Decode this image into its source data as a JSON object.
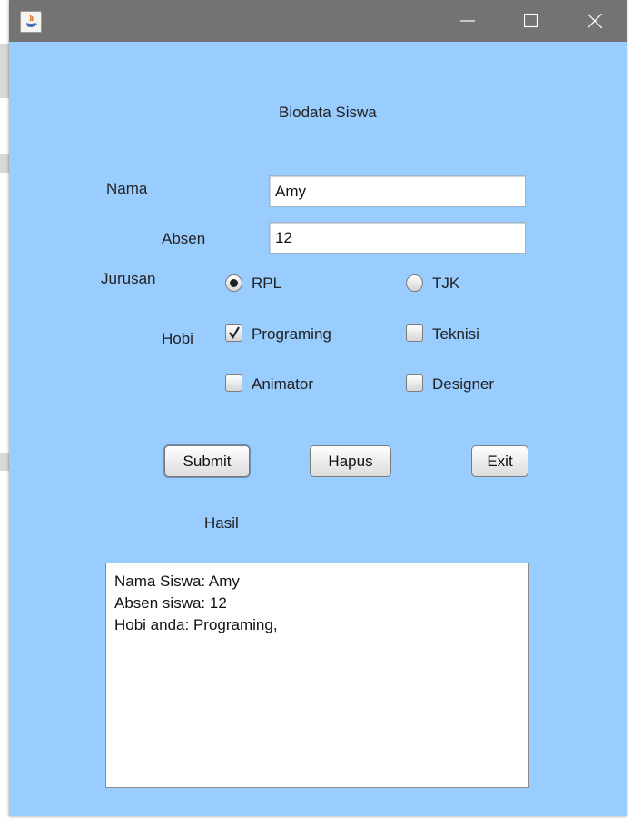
{
  "window": {
    "title": ""
  },
  "form": {
    "heading": "Biodata Siswa",
    "nama_label": "Nama",
    "nama_value": "Amy",
    "absen_label": "Absen",
    "absen_value": "12",
    "jurusan_label": "Jurusan",
    "jurusan_options": [
      {
        "label": "RPL",
        "selected": true
      },
      {
        "label": "TJK",
        "selected": false
      }
    ],
    "hobi_label": "Hobi",
    "hobi_options": [
      {
        "label": "Programing",
        "checked": true
      },
      {
        "label": "Teknisi",
        "checked": false
      },
      {
        "label": "Animator",
        "checked": false
      },
      {
        "label": "Designer",
        "checked": false
      }
    ]
  },
  "buttons": {
    "submit": "Submit",
    "hapus": "Hapus",
    "exit": "Exit"
  },
  "hasil": {
    "label": "Hasil",
    "lines": [
      "Nama Siswa: Amy",
      "Absen siswa: 12",
      "Hobi anda: Programing,"
    ]
  },
  "colors": {
    "window_bg": "#99ccff",
    "titlebar": "#737373"
  },
  "icons": {
    "app": "java-icon",
    "minimize": "minimize-icon",
    "maximize": "maximize-icon",
    "close": "close-icon"
  }
}
